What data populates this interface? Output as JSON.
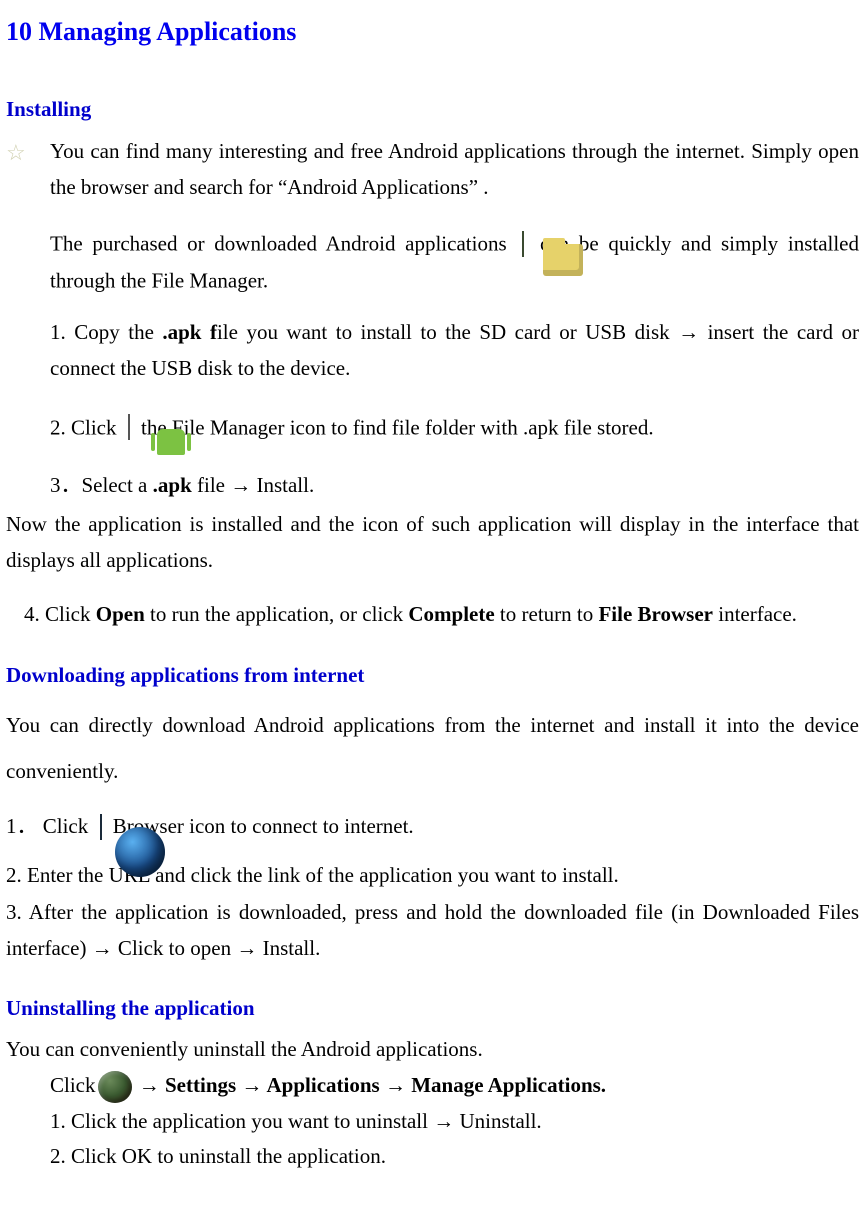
{
  "title": "10 Managing Applications",
  "installing": {
    "heading": "Installing",
    "star_text_1": "You  can  find  many  interesting  and  free  Android  applications  through  the  internet.  Simply open the browser and search for “Android Applications” .",
    "line2_a": "The  purchased  or  downloaded  Android  applications",
    "line2_b": "can  be  quickly  and  simply installed through the File Manager.",
    "step1_a": "1. Copy the ",
    "step1_bold": ".apk f",
    "step1_b": "ile you want to install to the SD card or USB disk → insert the card or connect the USB disk to the device.",
    "step2_a": "2. Click",
    "step2_b": "  the File Manager icon to find file folder with .apk file stored.",
    "step3_a": " 3．Select a ",
    "step3_bold": ".apk",
    "step3_b": " file → Install.",
    "step3_after": "    Now the application is installed and the icon of such application will display in the interface that displays all applications.",
    "step4_a": "4. Click ",
    "step4_open": "Open",
    "step4_b": " to run the application, or click ",
    "step4_complete": "Complete",
    "step4_c": " to return to ",
    "step4_fb": "File Browser",
    "step4_d": " interface."
  },
  "downloading": {
    "heading": "Downloading applications from internet",
    "intro": "You can directly download Android applications from the internet and install it into the device conveniently.",
    "s1_a": "1．  Click",
    "s1_b": " Browser icon to connect to internet.",
    "s2": "2.    Enter the URL and click the link of the application you want to install.",
    "s3": "3.   After the application is downloaded, press and hold the downloaded file (in Downloaded Files interface) → Click to open → Install."
  },
  "uninstalling": {
    "heading": "Uninstalling the application",
    "intro": "You can conveniently uninstall the Android applications.",
    "click_a": "Click",
    "click_path": " → Settings → Applications → Manage Applications.",
    "u1": "1.    Click the application you want to uninstall → Uninstall.",
    "u2": "2.    Click OK to uninstall the application."
  }
}
